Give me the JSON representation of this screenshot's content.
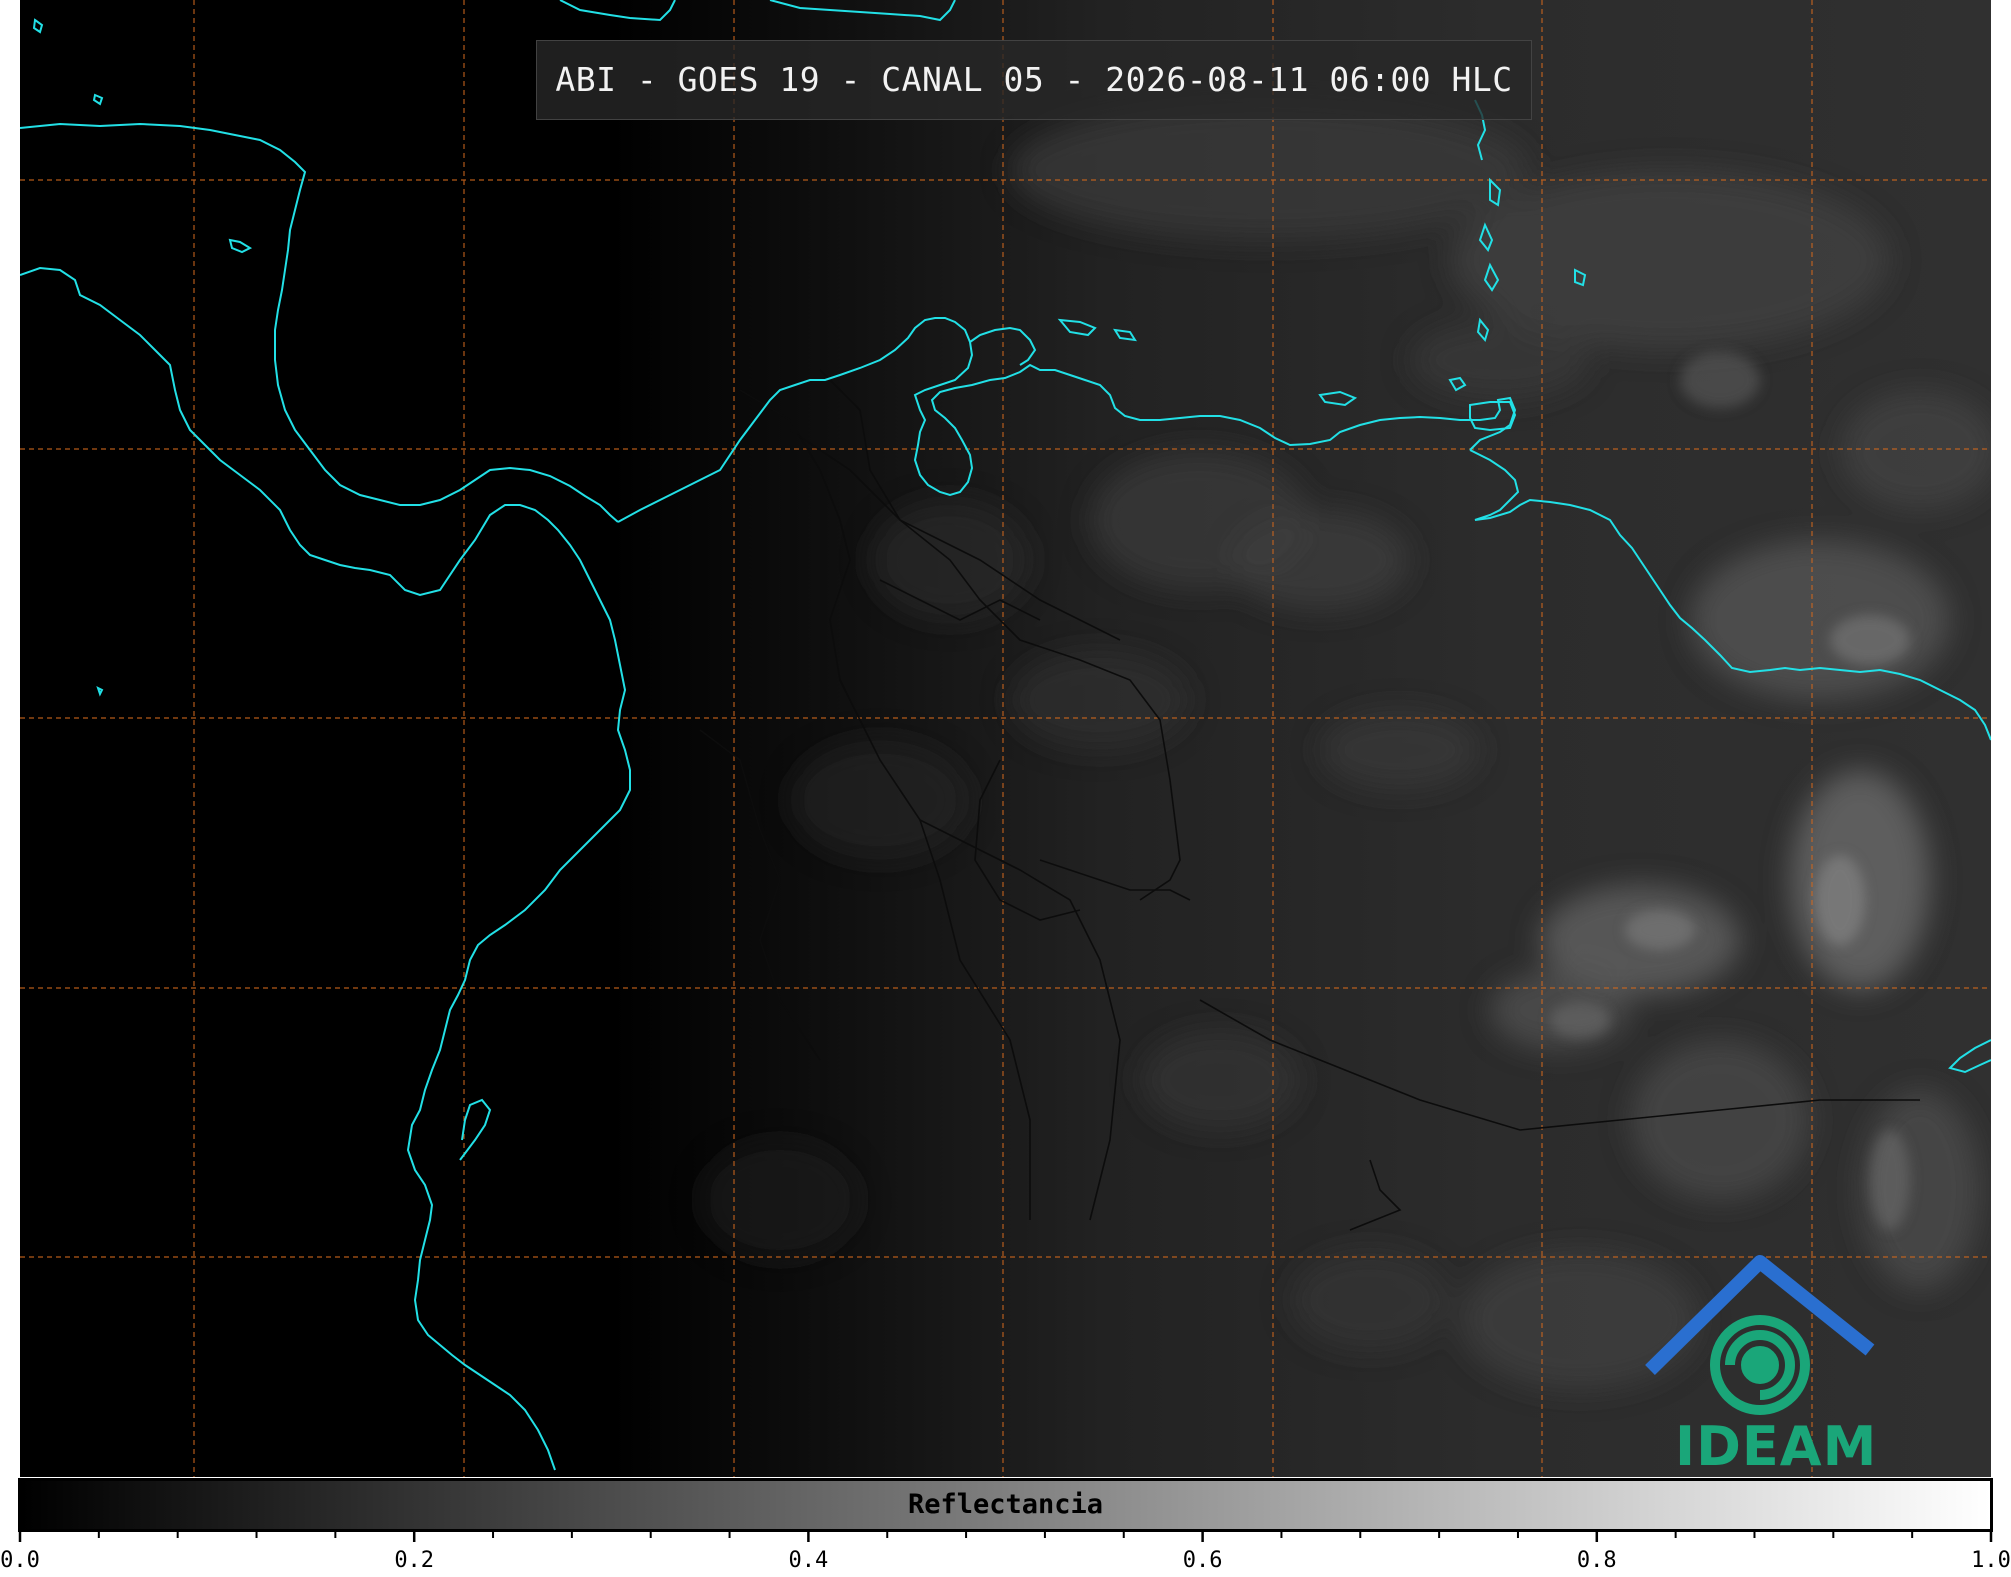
{
  "map": {
    "title": "ABI - GOES 19 - CANAL 05 - 2026-08-11 06:00 HLC",
    "background_color": "#000000",
    "coastline_color": "#22e0e6",
    "border_color": "#111111",
    "gridline_color": "#d2691e",
    "logo_text": "IDEAM",
    "logo_colors": {
      "roof": "#2a6fd0",
      "swirl": "#1aa679",
      "text": "#1aa679"
    }
  },
  "colorbar": {
    "label": "Reflectancia",
    "ticks": [
      "0.0",
      "0.2",
      "0.4",
      "0.6",
      "0.8",
      "1.0"
    ],
    "range": [
      0.0,
      1.0
    ],
    "colormap": "gray"
  }
}
